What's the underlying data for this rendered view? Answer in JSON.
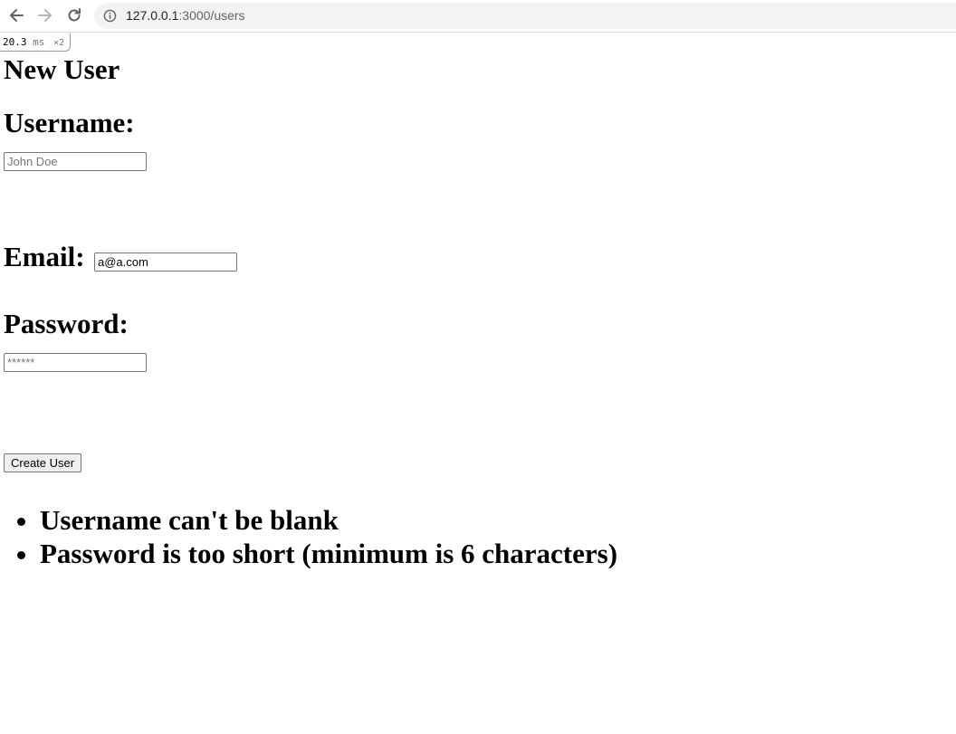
{
  "browser": {
    "url_host": "127.0.0.1",
    "url_rest": ":3000/users"
  },
  "profiler": {
    "time": "20.3",
    "unit": "ms",
    "count": "×2"
  },
  "page": {
    "title": "New User"
  },
  "form": {
    "username": {
      "label": "Username:",
      "placeholder": "John Doe",
      "value": ""
    },
    "email": {
      "label": "Email:",
      "value": "a@a.com"
    },
    "password": {
      "label": "Password:",
      "placeholder": "******",
      "value": ""
    },
    "submit_label": "Create User"
  },
  "errors": [
    "Username can't be blank",
    "Password is too short (minimum is 6 characters)"
  ]
}
